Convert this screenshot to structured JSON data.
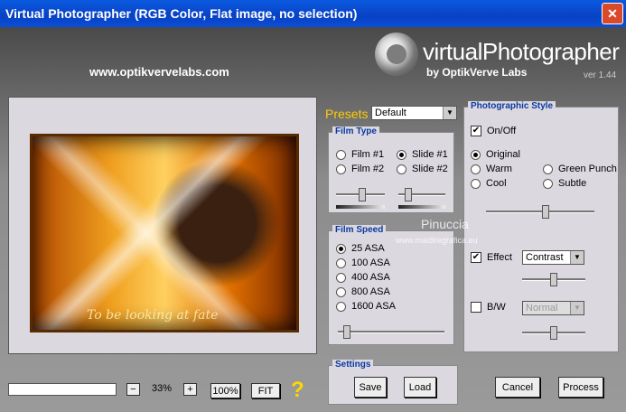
{
  "window": {
    "title": "Virtual Photographer (RGB Color, Flat image, no selection)",
    "close_glyph": "✕"
  },
  "header": {
    "url": "www.optikvervelabs.com",
    "brand": "virtualPhotographer",
    "brand_by": "by OptikVerve Labs",
    "version": "ver 1.44"
  },
  "preview": {
    "watermark": "To be looking at fate"
  },
  "presets": {
    "label": "Presets",
    "value": "Default"
  },
  "film_type": {
    "title": "Film Type",
    "options": [
      {
        "label": "Film #1",
        "selected": false
      },
      {
        "label": "Slide #1",
        "selected": true
      },
      {
        "label": "Film #2",
        "selected": false
      },
      {
        "label": "Slide #2",
        "selected": false
      }
    ],
    "slider1": 0.55,
    "slider2": 0.15
  },
  "film_speed": {
    "title": "Film Speed",
    "options": [
      {
        "label": "25 ASA",
        "selected": true
      },
      {
        "label": "100 ASA",
        "selected": false
      },
      {
        "label": "400 ASA",
        "selected": false
      },
      {
        "label": "800 ASA",
        "selected": false
      },
      {
        "label": "1600 ASA",
        "selected": false
      }
    ],
    "slider": 0.05
  },
  "style": {
    "title": "Photographic Style",
    "onoff": "On/Off",
    "onoff_checked": true,
    "options": [
      {
        "label": "Original",
        "selected": true
      },
      {
        "label": "Warm",
        "selected": false
      },
      {
        "label": "Green Punch",
        "selected": false
      },
      {
        "label": "Cool",
        "selected": false
      },
      {
        "label": "Subtle",
        "selected": false
      }
    ],
    "slider": 0.55,
    "effect_label": "Effect",
    "effect_checked": true,
    "effect_value": "Contrast",
    "effect_slider": 0.5,
    "bw_label": "B/W",
    "bw_checked": false,
    "bw_value": "Normal",
    "bw_slider": 0.5
  },
  "watermark": {
    "line1": "Pinuccia",
    "line2": "www.maidiregrafica.eu"
  },
  "settings": {
    "title": "Settings",
    "save": "Save",
    "load": "Load"
  },
  "zoom": {
    "minus": "−",
    "value": "33%",
    "plus": "+",
    "hundred": "100%",
    "fit": "FIT",
    "help": "?"
  },
  "actions": {
    "cancel": "Cancel",
    "process": "Process"
  }
}
